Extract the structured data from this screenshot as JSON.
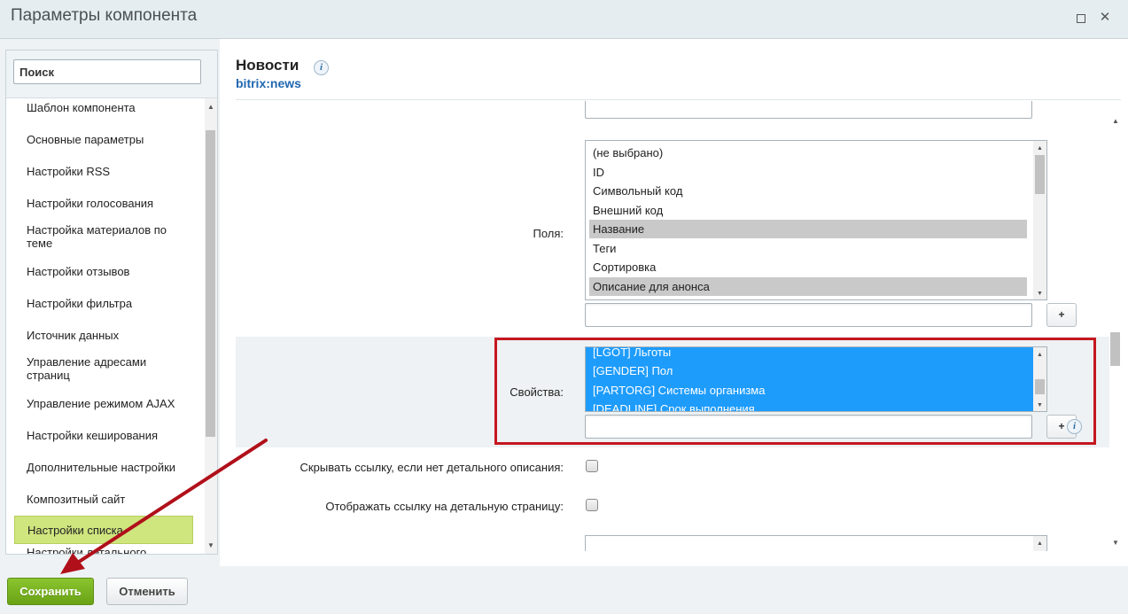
{
  "window": {
    "title": "Параметры компонента",
    "maximize_icon": "maximize-icon",
    "close_icon": "close-icon",
    "close_glyph": "✕"
  },
  "sidebar": {
    "search_placeholder": "Поиск",
    "items": [
      {
        "label": "Шаблон компонента"
      },
      {
        "label": "Основные параметры"
      },
      {
        "label": "Настройки RSS"
      },
      {
        "label": "Настройки голосования"
      },
      {
        "label": "Настройка материалов по теме"
      },
      {
        "label": "Настройки отзывов"
      },
      {
        "label": "Настройки фильтра"
      },
      {
        "label": "Источник данных"
      },
      {
        "label": "Управление адресами страниц"
      },
      {
        "label": "Управление режимом AJAX"
      },
      {
        "label": "Настройки кеширования"
      },
      {
        "label": "Дополнительные настройки"
      },
      {
        "label": "Композитный сайт"
      },
      {
        "label": "Настройки списка",
        "active": true
      },
      {
        "label": "Настройки детального просмотра"
      }
    ]
  },
  "component": {
    "name": "Новости",
    "code": "bitrix:news",
    "info_glyph": "i"
  },
  "fields": {
    "label": "Поля:",
    "options": [
      {
        "label": "(не выбрано)",
        "selected": false
      },
      {
        "label": "ID",
        "selected": false
      },
      {
        "label": "Символьный код",
        "selected": false
      },
      {
        "label": "Внешний код",
        "selected": false
      },
      {
        "label": "Название",
        "selected": true
      },
      {
        "label": "Теги",
        "selected": false
      },
      {
        "label": "Сортировка",
        "selected": false
      },
      {
        "label": "Описание для анонса",
        "selected": true
      }
    ],
    "add_label": "+"
  },
  "properties": {
    "label": "Свойства:",
    "options": [
      {
        "label": "[LGOT] Льготы",
        "selected": true
      },
      {
        "label": "[GENDER] Пол",
        "selected": true
      },
      {
        "label": "[PARTORG] Системы организма",
        "selected": true
      },
      {
        "label": "[DEADLINE] Срок выполнения",
        "selected": true
      }
    ],
    "add_label": "+",
    "highlight_color": "#c5171f"
  },
  "options": {
    "hide_link_label": "Скрывать ссылку, если нет детального описания:",
    "show_link_label": "Отображать ссылку на детальную страницу:"
  },
  "footer": {
    "save_label": "Сохранить",
    "cancel_label": "Отменить"
  },
  "colors": {
    "accent_green": "#6aa215",
    "selection_blue": "#1e9cfc",
    "active_nav": "#cfe57e",
    "arrow": "#b0101a"
  }
}
